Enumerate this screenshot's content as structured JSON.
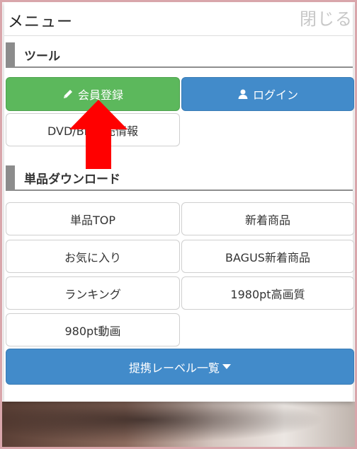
{
  "menu": {
    "title": "メニュー",
    "close_label": "閉じる"
  },
  "sections": {
    "tools": {
      "title": "ツール",
      "register_label": "会員登録",
      "login_label": "ログイン",
      "dvd_label": "DVD/BD発売情報"
    },
    "downloads": {
      "title": "単品ダウンロード",
      "items": [
        {
          "label": "単品TOP"
        },
        {
          "label": "新着商品"
        },
        {
          "label": "お気に入り"
        },
        {
          "label": "BAGUS新着商品"
        },
        {
          "label": "ランキング"
        },
        {
          "label": "1980pt高画質"
        },
        {
          "label": "980pt動画"
        }
      ],
      "partner_label": "提携レーベル一覧"
    }
  },
  "icons": {
    "register": "pencil-icon",
    "login": "user-icon",
    "partner": "caret-down-icon"
  },
  "colors": {
    "register_button": "#5cb85c",
    "login_button": "#428bca",
    "partner_button": "#428bca",
    "annotation_arrow": "#ff0000",
    "outer_border": "#d9a6ab"
  }
}
